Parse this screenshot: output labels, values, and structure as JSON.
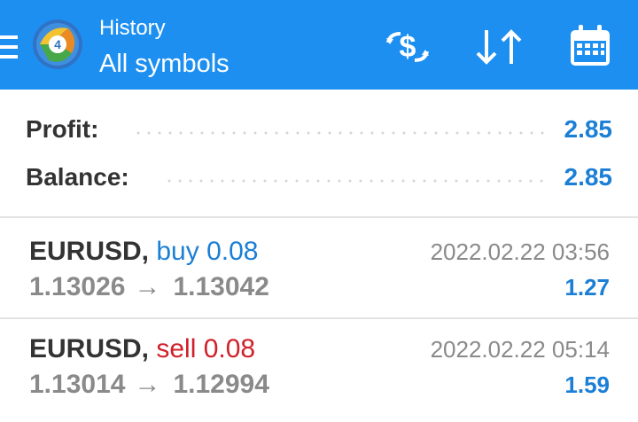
{
  "header": {
    "title": "History",
    "subtitle": "All symbols",
    "menu_icon": "hamburger-menu-icon",
    "logo_icon": "metatrader-logo",
    "tools": [
      {
        "name": "currency-exchange-icon"
      },
      {
        "name": "sort-icon"
      },
      {
        "name": "calendar-icon"
      }
    ],
    "background_color": "#1d8ff0"
  },
  "summary": {
    "profit_label": "Profit:",
    "profit_value": "2.85",
    "balance_label": "Balance:",
    "balance_value": "2.85"
  },
  "deals": [
    {
      "symbol": "EURUSD,",
      "type": "buy 0.08",
      "time": "2022.02.22 03:56",
      "open_price": "1.13026",
      "arrow": "→",
      "close_price": "1.13042",
      "profit": "1.27"
    },
    {
      "symbol": "EURUSD,",
      "type": "sell 0.08",
      "time": "2022.02.22 05:14",
      "open_price": "1.13014",
      "arrow": "→",
      "close_price": "1.12994",
      "profit": "1.59"
    }
  ],
  "colors": {
    "accent": "#1b7fd6",
    "buy": "#1b7fd6",
    "sell": "#d0202a",
    "muted": "#8a8a8a",
    "text": "#333333"
  }
}
